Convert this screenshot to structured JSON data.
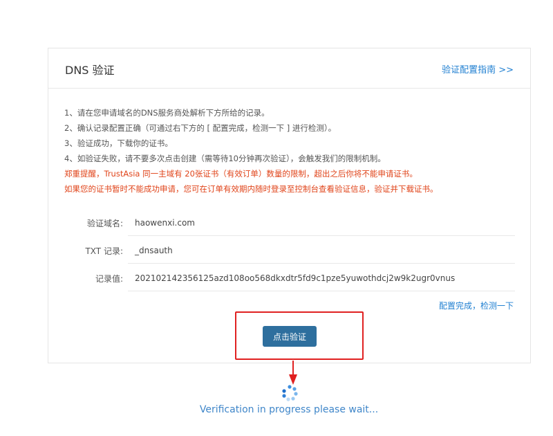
{
  "header": {
    "title": "DNS 验证",
    "guide_link": "验证配置指南 >>"
  },
  "notes": {
    "line1": "1、请在您申请域名的DNS服务商处解析下方所给的记录。",
    "line2": "2、确认记录配置正确（可通过右下方的 [ 配置完成，检测一下 ] 进行检测）。",
    "line3": "3、验证成功，下载你的证书。",
    "line4": "4、如验证失败，请不要多次点击创建（需等待10分钟再次验证），会触发我们的限制机制。",
    "warn1": "郑重提醒，TrustAsia 同一主域有 20张证书（有效订单）数量的限制，超出之后你将不能申请证书。",
    "warn2": "如果您的证书暂时不能成功申请，您可在订单有效期内随时登录至控制台查看验证信息，验证并下载证书。"
  },
  "form": {
    "domain_label": "验证域名:",
    "domain_value": "haowenxi.com",
    "txt_label": "TXT 记录:",
    "txt_value": "_dnsauth",
    "record_label": "记录值:",
    "record_value": "202102142356125azd108oo568dkxdtr5fd9c1pze5yuwothdcj2w9k2ugr0vnus"
  },
  "actions": {
    "check_link": "配置完成，检测一下",
    "verify_button": "点击验证"
  },
  "status": {
    "loading_text": "Verification in progress please wait..."
  },
  "colors": {
    "accent": "#1f7fd1",
    "button": "#2e6f9e",
    "warning": "#e0441a",
    "highlight": "#e02020"
  }
}
